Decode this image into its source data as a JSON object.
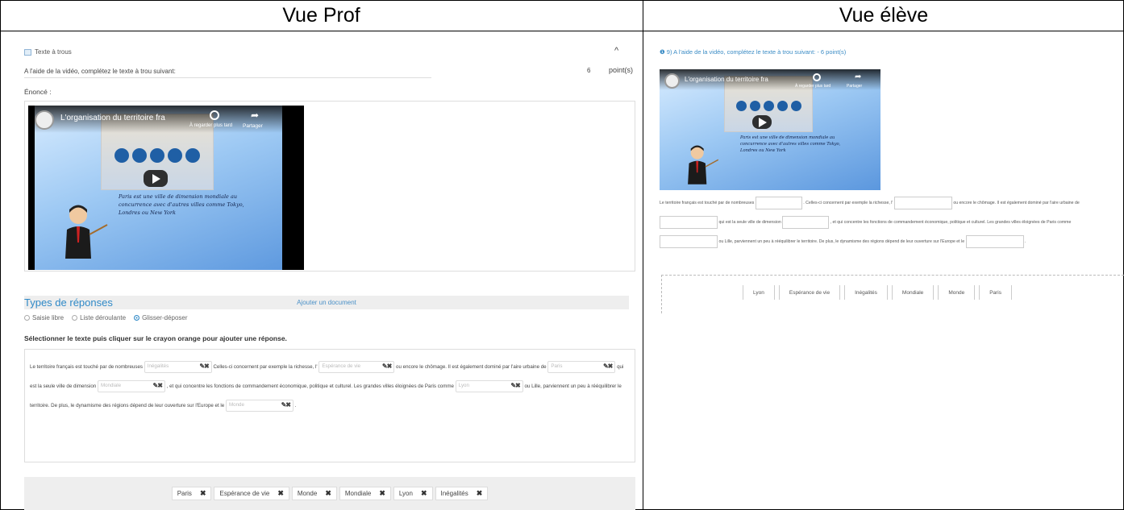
{
  "headers": {
    "left": "Vue Prof",
    "right": "Vue élève"
  },
  "teacher": {
    "section_label": "Texte à trous",
    "collapse_glyph": "^",
    "consigne": "A l'aide de la vidéo, complétez le texte à trou suivant:",
    "points_value": "6",
    "points_label": "point(s)",
    "enonce_label": "Énoncé :",
    "video": {
      "title": "L'organisation du territoire franç...",
      "watch_later": "À regarder plus tard",
      "share": "Partager",
      "handwriting": [
        "Paris est une ville de dimension mondiale au",
        "concurrence avec d'autres villes comme Tokyo,",
        "Londres ou New York"
      ]
    },
    "add_document": "Ajouter un document",
    "types_title": "Types de réponses",
    "answer_types": [
      {
        "label": "Saisie libre",
        "selected": false
      },
      {
        "label": "Liste déroulante",
        "selected": false
      },
      {
        "label": "Glisser-déposer",
        "selected": true
      }
    ],
    "select_hint": "Sélectionner le texte puis cliquer sur le crayon orange pour ajouter une réponse.",
    "text": {
      "s1": "Le territoire français est touché par de nombreuses",
      "g1": "Inégalités",
      "s2": "Celles-ci concernent par exemple la richesse, l'",
      "g2": "Espérance de vie",
      "s3": "ou encore le chômage. Il est également dominé par l'aire urbaine de",
      "g3": "Paris",
      "s4": "qui est la seule ville de dimension",
      "g4": "Mondiale",
      "s5": ", et qui concentre les fonctions de commandement économique, politique et culturel. Les grandes villes éloignées de Paris comme",
      "g5": "Lyon",
      "s6": "ou Lille, parviennent un peu à rééquilibrer le territoire. De plus, le dynamisme des régions dépend de leur ouverture sur l'Europe et le",
      "g6": "Monde",
      "s7": "."
    },
    "bank": [
      "Paris",
      "Espérance de vie",
      "Monde",
      "Mondiale",
      "Lyon",
      "Inégalités"
    ],
    "bank_remove_glyph": "✖",
    "gap_edit_glyph": "✎✖"
  },
  "student": {
    "question_title": "❶ 9) A l'aide de la vidéo, complétez le texte à trou suivant: - 6 point(s)",
    "video": {
      "title": "L'organisation du territoire franç...",
      "watch_later": "À regarder plus tard",
      "share": "Partager",
      "handwriting": [
        "Paris est une ville de dimension mondiale au",
        "concurrence avec d'autres villes comme Tokyo,",
        "Londres ou New York"
      ]
    },
    "text": {
      "s1": "Le territoire français est touché par de nombreuses",
      "s2": ". Celles-ci concernent par exemple la richesse, l'",
      "s3": "ou encore le chômage. Il est également",
      "s4": "dominé par l'aire urbaine de",
      "s5": "qui est la seule ville de dimension",
      "s6": ", et qui concentre les fonctions de commandement économique, politique et culturel.",
      "s7": "Les grandes villes éloignées de Paris comme",
      "s8": "ou Lille, parviennent un peu à rééquilibrer le territoire. De plus, le dynamisme des régions dépend de leur ouverture sur l'Europe et",
      "s9": "le",
      "s10": "."
    },
    "bank": [
      "Lyon",
      "Espérance de vie",
      "Inégalités",
      "Mondiale",
      "Monde",
      "Paris"
    ]
  }
}
